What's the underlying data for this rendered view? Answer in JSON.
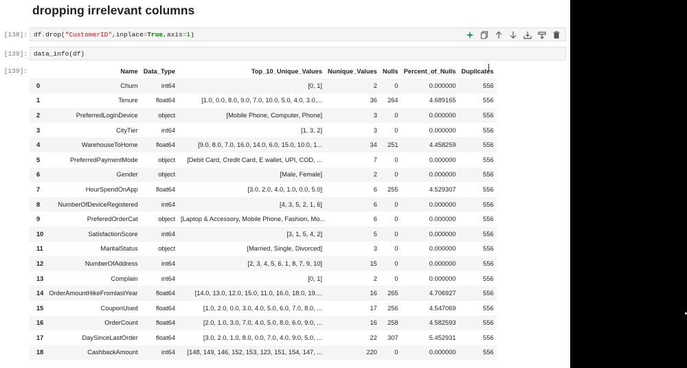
{
  "heading": "dropping irrelevant columns",
  "cells": [
    {
      "prompt": "[138]:",
      "code_parts": [
        {
          "t": "df",
          "c": ""
        },
        {
          "t": ".",
          "c": "o"
        },
        {
          "t": "drop(",
          "c": ""
        },
        {
          "t": "\"CustomerID\"",
          "c": "s"
        },
        {
          "t": ",inplace",
          "c": ""
        },
        {
          "t": "=",
          "c": "o"
        },
        {
          "t": "True",
          "c": "k"
        },
        {
          "t": ",axis",
          "c": ""
        },
        {
          "t": "=",
          "c": "o"
        },
        {
          "t": "1",
          "c": "n"
        },
        {
          "t": ")",
          "c": ""
        }
      ]
    },
    {
      "prompt": "[139]:",
      "code": "data_info(df)"
    }
  ],
  "output_prompt": "[139]:",
  "toolbar": [
    "sparkle-icon",
    "copy-icon",
    "move-up-icon",
    "move-down-icon",
    "insert-below-icon",
    "merge-icon",
    "delete-icon"
  ],
  "colors": {
    "cell_bg": "#f5f5f5",
    "sparkle": "#1a9e4b",
    "prompt": "#6e7781"
  },
  "table": {
    "headers": [
      "",
      "Name",
      "Data_Type",
      "Top_10_Unique_Values",
      "Nunique_Values",
      "Nulls",
      "Percent_of_Nulls",
      "Duplicates"
    ],
    "rows": [
      [
        "0",
        "Churn",
        "int64",
        "[0, 1]",
        "2",
        "0",
        "0.000000",
        "556"
      ],
      [
        "1",
        "Tenure",
        "float64",
        "[1.0, 0.0, 8.0, 9.0, 7.0, 10.0, 5.0, 4.0, 3.0,...",
        "36",
        "264",
        "4.689165",
        "556"
      ],
      [
        "2",
        "PreferredLoginDevice",
        "object",
        "[Mobile Phone, Computer, Phone]",
        "3",
        "0",
        "0.000000",
        "556"
      ],
      [
        "3",
        "CityTier",
        "int64",
        "[1, 3, 2]",
        "3",
        "0",
        "0.000000",
        "556"
      ],
      [
        "4",
        "WarehouseToHome",
        "float64",
        "[9.0, 8.0, 7.0, 16.0, 14.0, 6.0, 15.0, 10.0, 1...",
        "34",
        "251",
        "4.458259",
        "556"
      ],
      [
        "5",
        "PreferredPaymentMode",
        "object",
        "[Debit Card, Credit Card, E wallet, UPI, COD, ...",
        "7",
        "0",
        "0.000000",
        "556"
      ],
      [
        "6",
        "Gender",
        "object",
        "[Male, Female]",
        "2",
        "0",
        "0.000000",
        "556"
      ],
      [
        "7",
        "HourSpendOnApp",
        "float64",
        "[3.0, 2.0, 4.0, 1.0, 0.0, 5.0]",
        "6",
        "255",
        "4.529307",
        "556"
      ],
      [
        "8",
        "NumberOfDeviceRegistered",
        "int64",
        "[4, 3, 5, 2, 1, 6]",
        "6",
        "0",
        "0.000000",
        "556"
      ],
      [
        "9",
        "PreferedOrderCat",
        "object",
        "[Laptop & Accessory, Mobile Phone, Fashion, Mo...",
        "6",
        "0",
        "0.000000",
        "556"
      ],
      [
        "10",
        "SatisfactionScore",
        "int64",
        "[3, 1, 5, 4, 2]",
        "5",
        "0",
        "0.000000",
        "556"
      ],
      [
        "11",
        "MaritalStatus",
        "object",
        "[Married, Single, Divorced]",
        "3",
        "0",
        "0.000000",
        "556"
      ],
      [
        "12",
        "NumberOfAddress",
        "int64",
        "[2, 3, 4, 5, 6, 1, 8, 7, 9, 10]",
        "15",
        "0",
        "0.000000",
        "556"
      ],
      [
        "13",
        "Complain",
        "int64",
        "[0, 1]",
        "2",
        "0",
        "0.000000",
        "556"
      ],
      [
        "14",
        "OrderAmountHikeFromlastYear",
        "float64",
        "[14.0, 13.0, 12.0, 15.0, 11.0, 16.0, 18.0, 19....",
        "16",
        "265",
        "4.706927",
        "556"
      ],
      [
        "15",
        "CouponUsed",
        "float64",
        "[1.0, 2.0, 0.0, 3.0, 4.0, 5.0, 6.0, 7.0, 8.0, ...",
        "17",
        "256",
        "4.547069",
        "556"
      ],
      [
        "16",
        "OrderCount",
        "float64",
        "[2.0, 1.0, 3.0, 7.0, 4.0, 5.0, 8.0, 6.0, 9.0, ...",
        "16",
        "258",
        "4.582593",
        "556"
      ],
      [
        "17",
        "DaySinceLastOrder",
        "float64",
        "[3.0, 2.0, 1.0, 8.0, 0.0, 7.0, 4.0, 9.0, 5.0, ...",
        "22",
        "307",
        "5.452931",
        "556"
      ],
      [
        "18",
        "CashbackAmount",
        "int64",
        "[148, 149, 146, 152, 153, 123, 151, 154, 147, ...",
        "220",
        "0",
        "0.000000",
        "556"
      ]
    ]
  }
}
